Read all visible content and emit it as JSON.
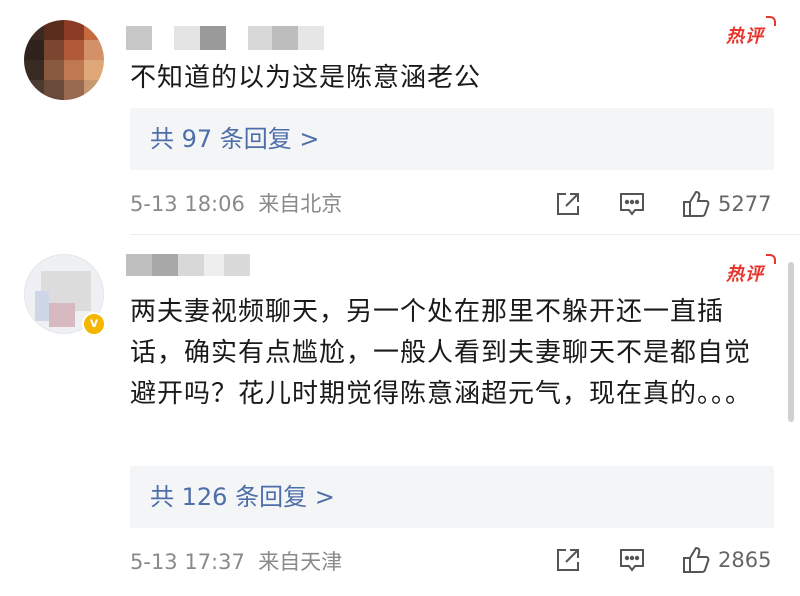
{
  "comments": [
    {
      "hot_label": "热评",
      "text": "不知道的以为这是陈意涵老公",
      "replies_label": "共 97 条回复 >",
      "time": "5-13 18:06",
      "location": "来自北京",
      "likes": "5277"
    },
    {
      "hot_label": "热评",
      "text": "两夫妻视频聊天，另一个处在那里不躲开还一直插话，确实有点尴尬，一般人看到夫妻聊天不是都自觉避开吗？花儿时期觉得陈意涵超元气，现在真的。。。",
      "replies_label": "共 126 条回复 >",
      "time": "5-13 17:37",
      "location": "来自天津",
      "likes": "2865",
      "vip_badge": "v"
    }
  ],
  "icons": {
    "share": "share-icon",
    "comment": "comment-icon",
    "like": "thumbs-up-icon"
  },
  "colors": {
    "hot": "#e5372e",
    "link": "#4d6fa8",
    "reply_bg": "#f4f5f7",
    "meta": "#8a8a8a"
  }
}
